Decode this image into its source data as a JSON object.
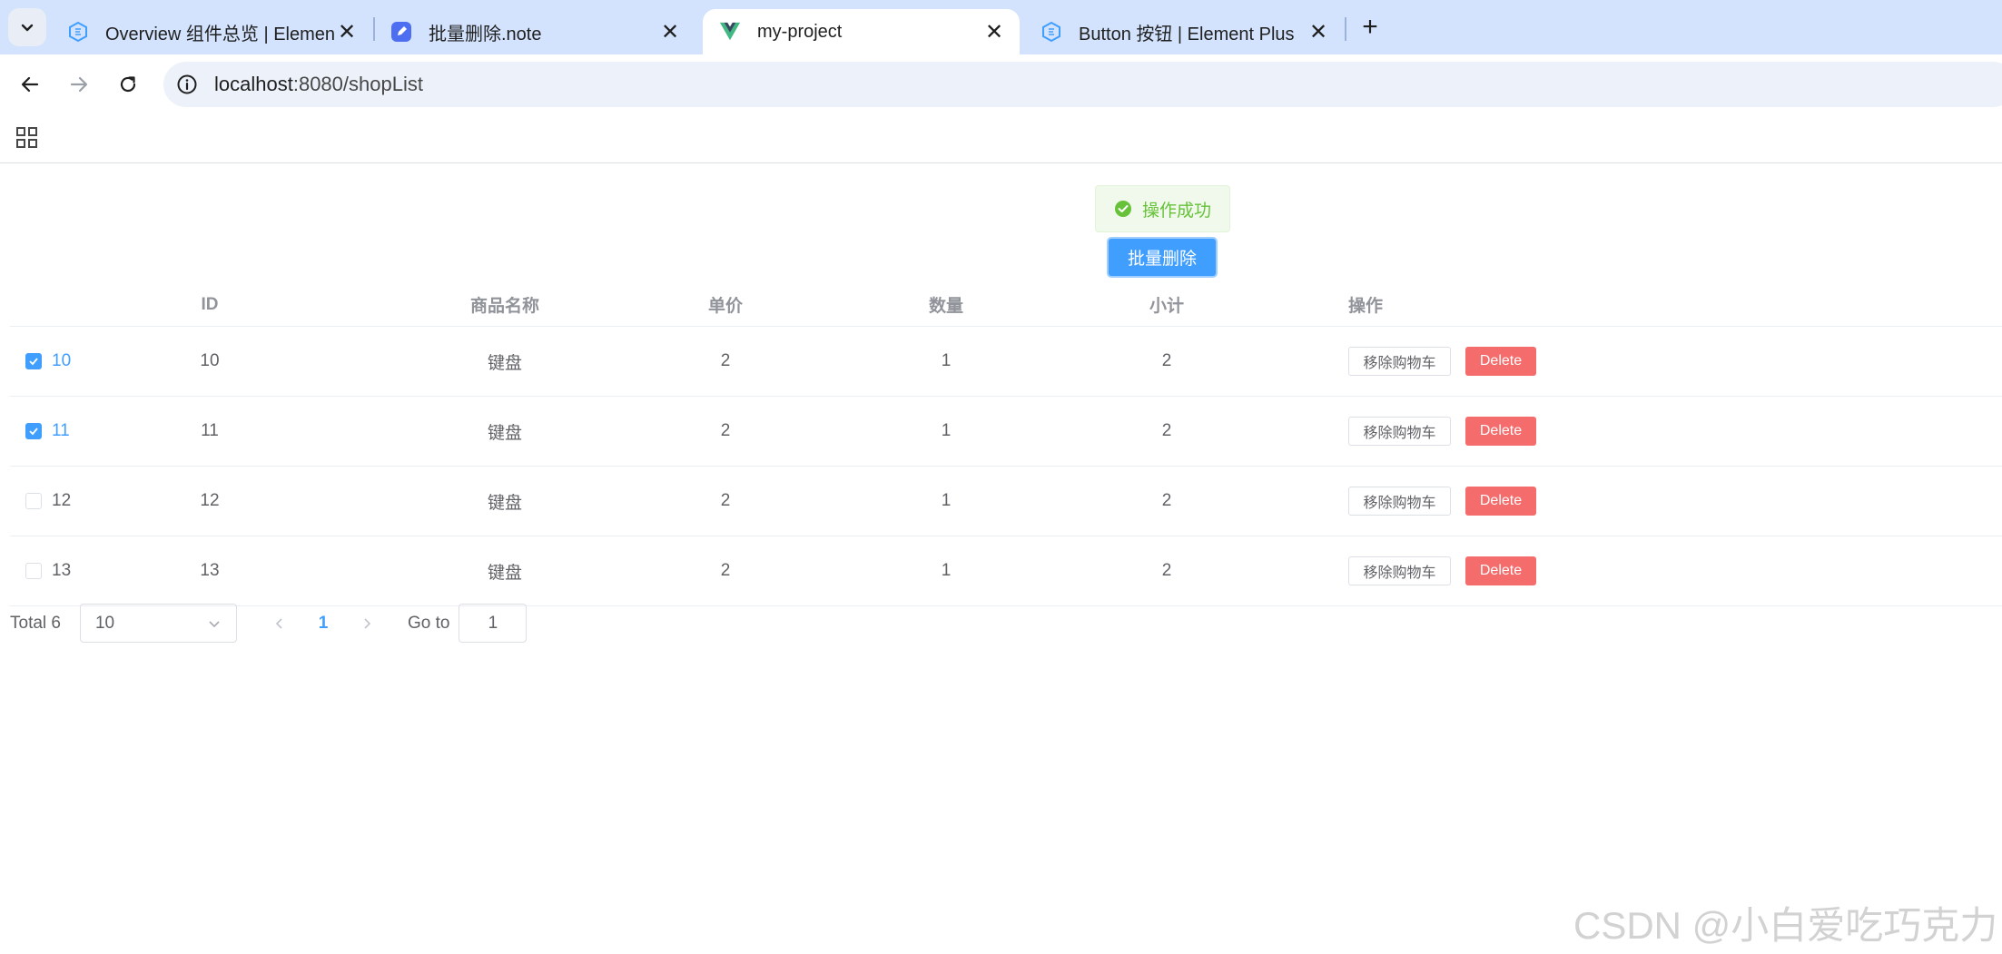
{
  "browser": {
    "tabs": [
      {
        "title": "Overview 组件总览 | Element",
        "close": "✕"
      },
      {
        "title": "批量删除.note",
        "close": "✕"
      },
      {
        "title": "my-project",
        "close": "✕"
      },
      {
        "title": "Button 按钮 | Element Plus",
        "close": "✕"
      }
    ],
    "new_tab": "+",
    "url_host": "localhost",
    "url_rest": ":8080/shopList"
  },
  "toast": {
    "message": "操作成功",
    "color": "#67c23a"
  },
  "batch_delete_label": "批量删除",
  "table": {
    "headers": {
      "id": "ID",
      "name": "商品名称",
      "price": "单价",
      "qty": "数量",
      "subtotal": "小计",
      "ops": "操作"
    },
    "rows": [
      {
        "sel_label": "10",
        "checked": true,
        "id": "10",
        "name": "键盘",
        "price": "2",
        "qty": "1",
        "subtotal": "2",
        "remove": "移除购物车",
        "delete": "Delete"
      },
      {
        "sel_label": "11",
        "checked": true,
        "id": "11",
        "name": "键盘",
        "price": "2",
        "qty": "1",
        "subtotal": "2",
        "remove": "移除购物车",
        "delete": "Delete"
      },
      {
        "sel_label": "12",
        "checked": false,
        "id": "12",
        "name": "键盘",
        "price": "2",
        "qty": "1",
        "subtotal": "2",
        "remove": "移除购物车",
        "delete": "Delete"
      },
      {
        "sel_label": "13",
        "checked": false,
        "id": "13",
        "name": "键盘",
        "price": "2",
        "qty": "1",
        "subtotal": "2",
        "remove": "移除购物车",
        "delete": "Delete"
      }
    ]
  },
  "pagination": {
    "total": "Total 6",
    "page_size": "10",
    "current_page": "1",
    "goto_label": "Go to",
    "goto_value": "1"
  },
  "watermark": "CSDN @小白爱吃巧克力",
  "colors": {
    "primary": "#409eff",
    "danger": "#f56c6c",
    "success": "#67c23a",
    "tabstrip": "#d3e3fd"
  }
}
